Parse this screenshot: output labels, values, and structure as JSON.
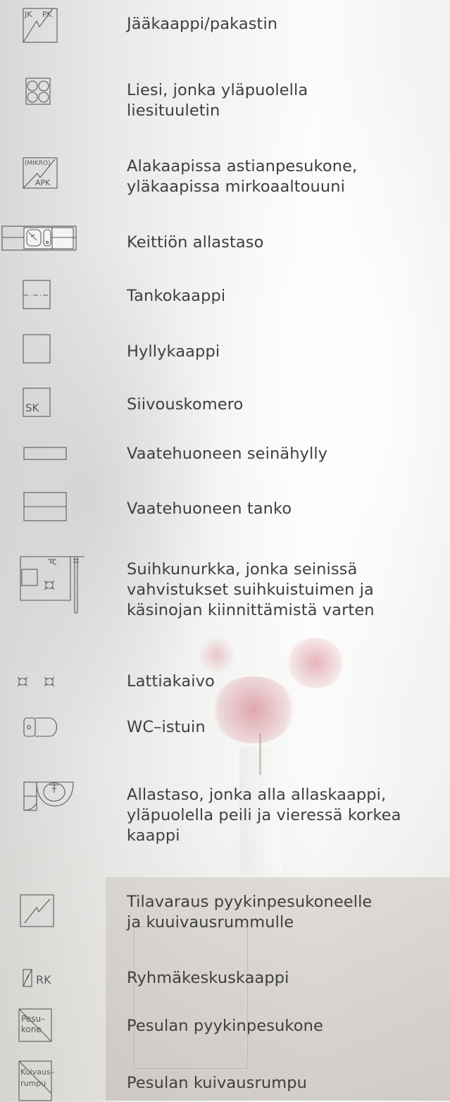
{
  "legend": {
    "items": [
      {
        "icon": "fridge-freezer-icon",
        "icon_text": [
          "JK",
          "PK"
        ],
        "label": "Jääkaappi/pakastin"
      },
      {
        "icon": "stove-icon",
        "label": "Liesi, jonka yläpuolella\nliesituuletin"
      },
      {
        "icon": "dishwasher-microwave-icon",
        "icon_text": [
          "(MIKRO)",
          "APK"
        ],
        "label": "Alakaapissa astianpesukone,\nyläkaapissa mirkoaaltouuni"
      },
      {
        "icon": "kitchen-sink-counter-icon",
        "label": "Keittiön allastaso"
      },
      {
        "icon": "rod-cabinet-icon",
        "label": "Tankokaappi"
      },
      {
        "icon": "shelf-cabinet-icon",
        "label": "Hyllykaappi"
      },
      {
        "icon": "cleaning-closet-icon",
        "icon_text": [
          "SK"
        ],
        "label": "Siivouskomero"
      },
      {
        "icon": "wall-shelf-icon",
        "label": "Vaatehuoneen seinähylly"
      },
      {
        "icon": "clothes-rod-icon",
        "label": "Vaatehuoneen tanko"
      },
      {
        "icon": "shower-corner-icon",
        "label": "Suihkunurkka, jonka seinissä\nvahvistukset suihkuistuimen ja\nkäsinojan kiinnittämistä varten"
      },
      {
        "icon": "floor-drain-icon",
        "label": "Lattiakaivo"
      },
      {
        "icon": "toilet-icon",
        "label": "WC–istuin"
      },
      {
        "icon": "washbasin-cabinet-icon",
        "label": "Allastaso, jonka alla allaskaappi,\nyläpuolella peili ja vieressä korkea\nkaappi"
      },
      {
        "icon": "laundry-space-icon",
        "label": "Tilavaraus pyykinpesukoneelle\nja kuuivausrummulle"
      },
      {
        "icon": "electrical-panel-icon",
        "icon_text": [
          "RK"
        ],
        "label": "Ryhmäkeskuskaappi"
      },
      {
        "icon": "washing-machine-icon",
        "icon_text": [
          "Pesu–",
          "kone"
        ],
        "label": "Pesulan pyykinpesukone"
      },
      {
        "icon": "tumble-dryer-icon",
        "icon_text": [
          "Kuivaus–",
          "rumpu"
        ],
        "label": "Pesulan kuivausrumpu"
      }
    ]
  },
  "colors": {
    "text": "#3f3f3f",
    "line": "#5a5a5a"
  }
}
